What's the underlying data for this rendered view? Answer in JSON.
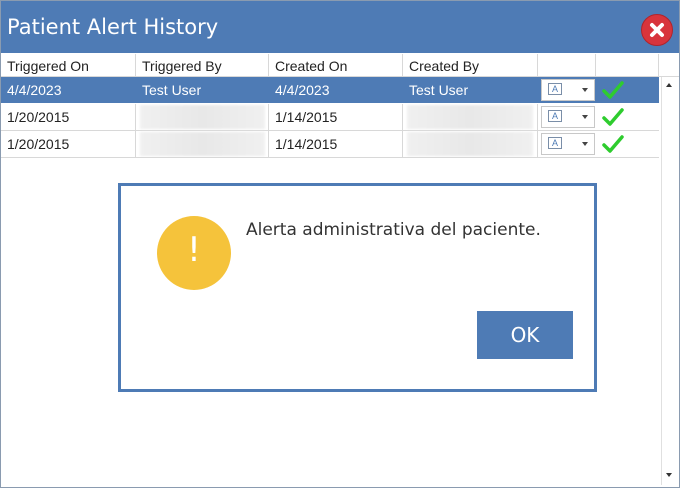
{
  "window": {
    "title": "Patient Alert History"
  },
  "colors": {
    "titlebar": "#4e7bb5",
    "selected_row": "#4e7bb5",
    "close": "#d8343c",
    "warning": "#f5c33b",
    "check": "#2ecc2e"
  },
  "table": {
    "headers": [
      "Triggered On",
      "Triggered By",
      "Created On",
      "Created By"
    ],
    "rows": [
      {
        "triggered_on": "4/4/2023",
        "triggered_by": "Test User",
        "created_on": "4/4/2023",
        "created_by": "Test User",
        "selected": true
      },
      {
        "triggered_on": "1/20/2015",
        "triggered_by": "",
        "created_on": "1/14/2015",
        "created_by": "",
        "selected": false
      },
      {
        "triggered_on": "1/20/2015",
        "triggered_by": "",
        "created_on": "1/14/2015",
        "created_by": "",
        "selected": false
      }
    ],
    "icons": {
      "language": "A",
      "status": "check-icon"
    }
  },
  "dialog": {
    "message": "Alerta administrativa del paciente.",
    "ok_label": "OK",
    "icon_glyph": "!"
  }
}
